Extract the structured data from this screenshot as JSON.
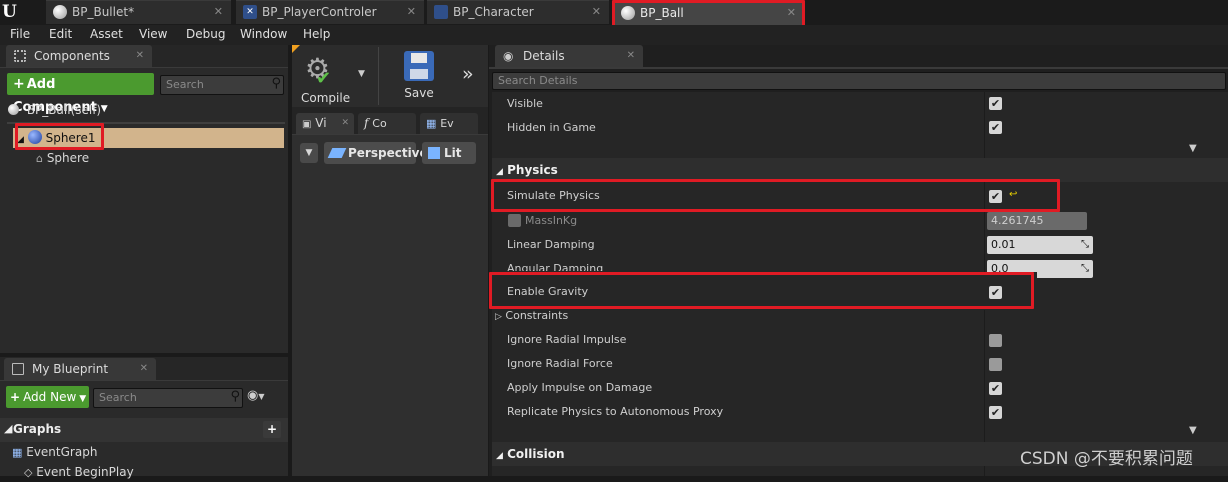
{
  "tabs": [
    {
      "label": "BP_Bullet*"
    },
    {
      "label": "BP_PlayerControler"
    },
    {
      "label": "BP_Character"
    },
    {
      "label": "BP_Ball"
    }
  ],
  "menu": [
    "File",
    "Edit",
    "Asset",
    "View",
    "Debug",
    "Window",
    "Help"
  ],
  "components": {
    "tab_label": "Components",
    "add_button": "Add Component",
    "search_placeholder": "Search",
    "self_label": "BP_Ball(self)",
    "items": [
      {
        "label": "Sphere1"
      },
      {
        "label": "Sphere"
      }
    ]
  },
  "toolbar": {
    "compile_label": "Compile",
    "save_label": "Save"
  },
  "viewport": {
    "tabs": [
      "Vi",
      "Co",
      "Ev"
    ],
    "perspective_label": "Perspective",
    "lit_label": "Lit"
  },
  "my_blueprint": {
    "tab_label": "My Blueprint",
    "add_new_label": "Add New",
    "search_placeholder": "Search",
    "graphs_label": "Graphs",
    "items": [
      {
        "label": "EventGraph"
      },
      {
        "label": "Event BeginPlay"
      }
    ]
  },
  "details": {
    "tab_label": "Details",
    "search_placeholder": "Search Details",
    "rendering_rows": [
      {
        "label": "Visible",
        "checked": true
      },
      {
        "label": "Hidden in Game",
        "checked": true
      }
    ],
    "physics_header": "Physics",
    "simulate_physics": {
      "label": "Simulate Physics",
      "checked": true
    },
    "mass": {
      "label": "MassInKg",
      "value": "4.261745"
    },
    "linear_damping": {
      "label": "Linear Damping",
      "value": "0.01"
    },
    "angular_damping": {
      "label": "Angular Damping",
      "value": "0.0"
    },
    "enable_gravity": {
      "label": "Enable Gravity",
      "checked": true
    },
    "constraints_label": "Constraints",
    "more_rows": [
      {
        "label": "Ignore Radial Impulse",
        "checked": false
      },
      {
        "label": "Ignore Radial Force",
        "checked": false
      },
      {
        "label": "Apply Impulse on Damage",
        "checked": true
      },
      {
        "label": "Replicate Physics to Autonomous Proxy",
        "checked": true
      }
    ],
    "collision_header": "Collision"
  },
  "watermark": "CSDN @不要积累问题",
  "colors": {
    "highlight": "#e01b24",
    "add_green": "#4b9a2f",
    "selected_row": "#d2b48c"
  }
}
